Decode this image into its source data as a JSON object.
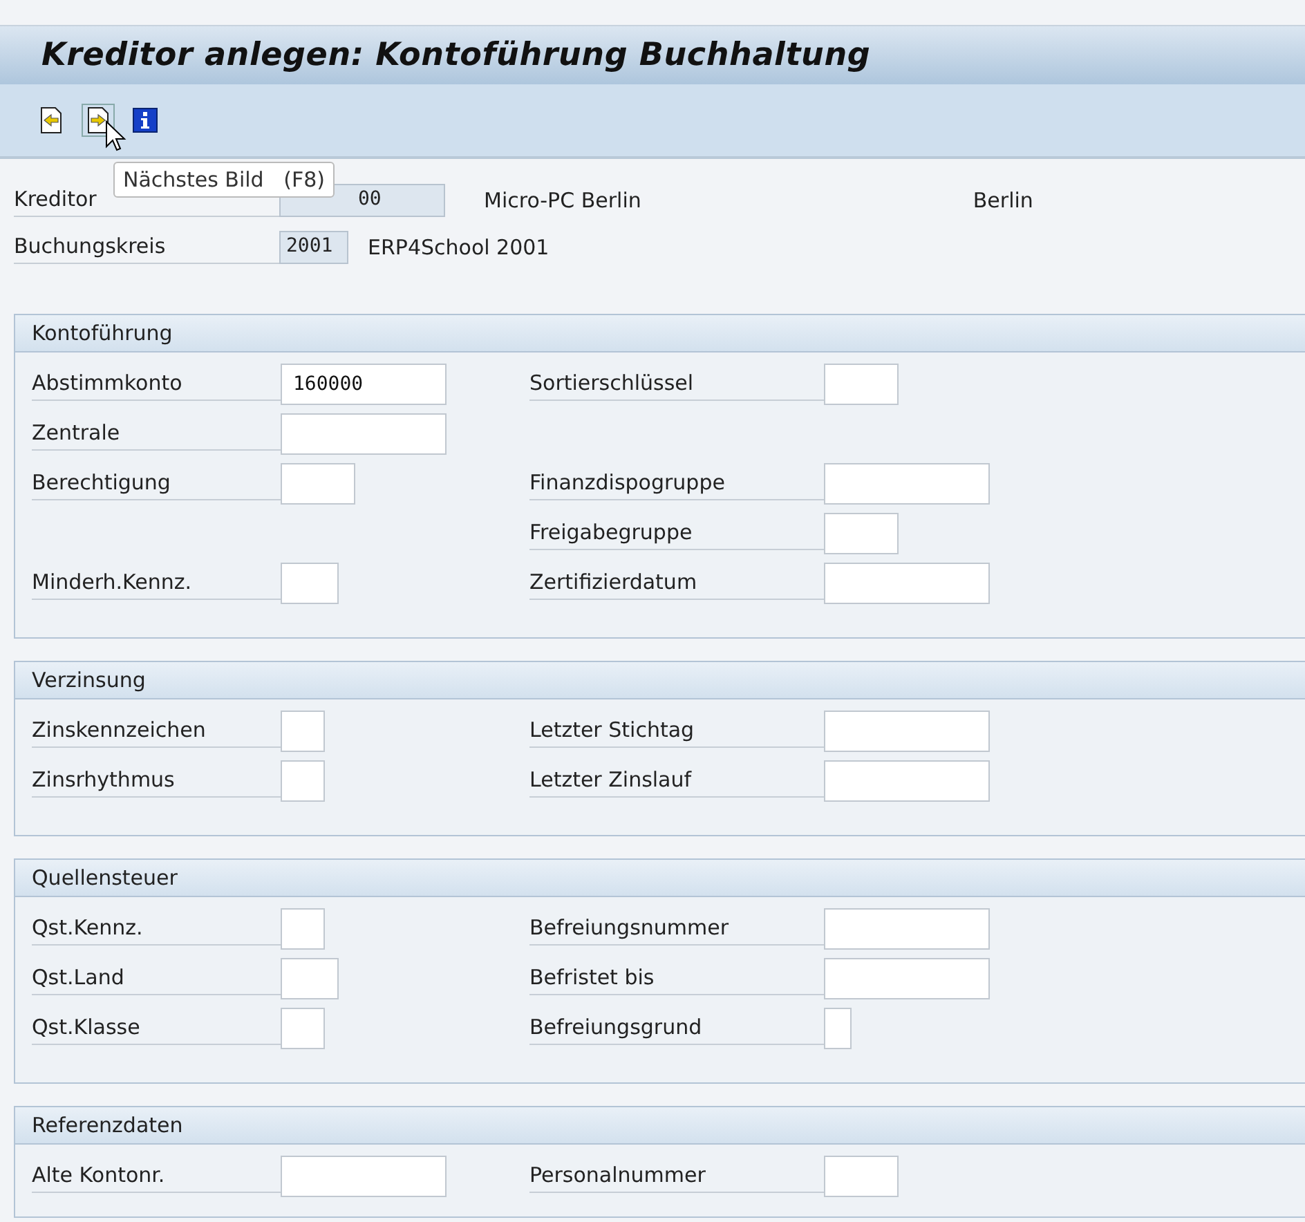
{
  "window": {
    "title": "Kreditor anlegen: Kontoführung Buchhaltung"
  },
  "toolbar": {
    "tooltip": "Nächstes Bild   (F8)"
  },
  "header": [
    {
      "label": "Kreditor",
      "value": "00",
      "description": "Micro-PC Berlin",
      "city": "Berlin",
      "covered": true
    },
    {
      "label": "Buchungskreis",
      "value": "2001",
      "description": "ERP4School 2001",
      "covered": false
    }
  ],
  "sections": [
    {
      "title": "Kontoführung",
      "rows": [
        [
          {
            "label": "Abstimmkonto",
            "value": "160000",
            "kind": "long"
          },
          {
            "label": "Sortierschlüssel",
            "kind": "short"
          }
        ],
        [
          {
            "label": "Zentrale",
            "kind": "long"
          },
          null
        ],
        [
          {
            "label": "Berechtigung",
            "kind": "short"
          },
          {
            "label": "Finanzdispogruppe",
            "kind": "long"
          }
        ],
        [
          null,
          {
            "label": "Freigabegruppe",
            "kind": "short"
          }
        ],
        [
          {
            "label": "Minderh.Kennz.",
            "kind": "mini"
          },
          {
            "label": "Zertifizierdatum",
            "kind": "long"
          }
        ]
      ]
    },
    {
      "title": "Verzinsung",
      "rows": [
        [
          {
            "label": "Zinskennzeichen",
            "kind": "tiny"
          },
          {
            "label": "Letzter Stichtag",
            "kind": "long"
          }
        ],
        [
          {
            "label": "Zinsrhythmus",
            "kind": "tiny"
          },
          {
            "label": "Letzter Zinslauf",
            "kind": "long"
          }
        ]
      ]
    },
    {
      "title": "Quellensteuer",
      "rows": [
        [
          {
            "label": "Qst.Kennz.",
            "kind": "tiny"
          },
          {
            "label": "Befreiungsnummer",
            "kind": "long"
          }
        ],
        [
          {
            "label": "Qst.Land",
            "kind": "mini"
          },
          {
            "label": "Befristet bis",
            "kind": "long"
          }
        ],
        [
          {
            "label": "Qst.Klasse",
            "kind": "tiny"
          },
          {
            "label": "Befreiungsgrund",
            "kind": "char"
          }
        ]
      ]
    },
    {
      "title": "Referenzdaten",
      "rows": [
        [
          {
            "label": "Alte Kontonr.",
            "kind": "long"
          },
          {
            "label": "Personalnummer",
            "kind": "short"
          }
        ]
      ]
    }
  ]
}
